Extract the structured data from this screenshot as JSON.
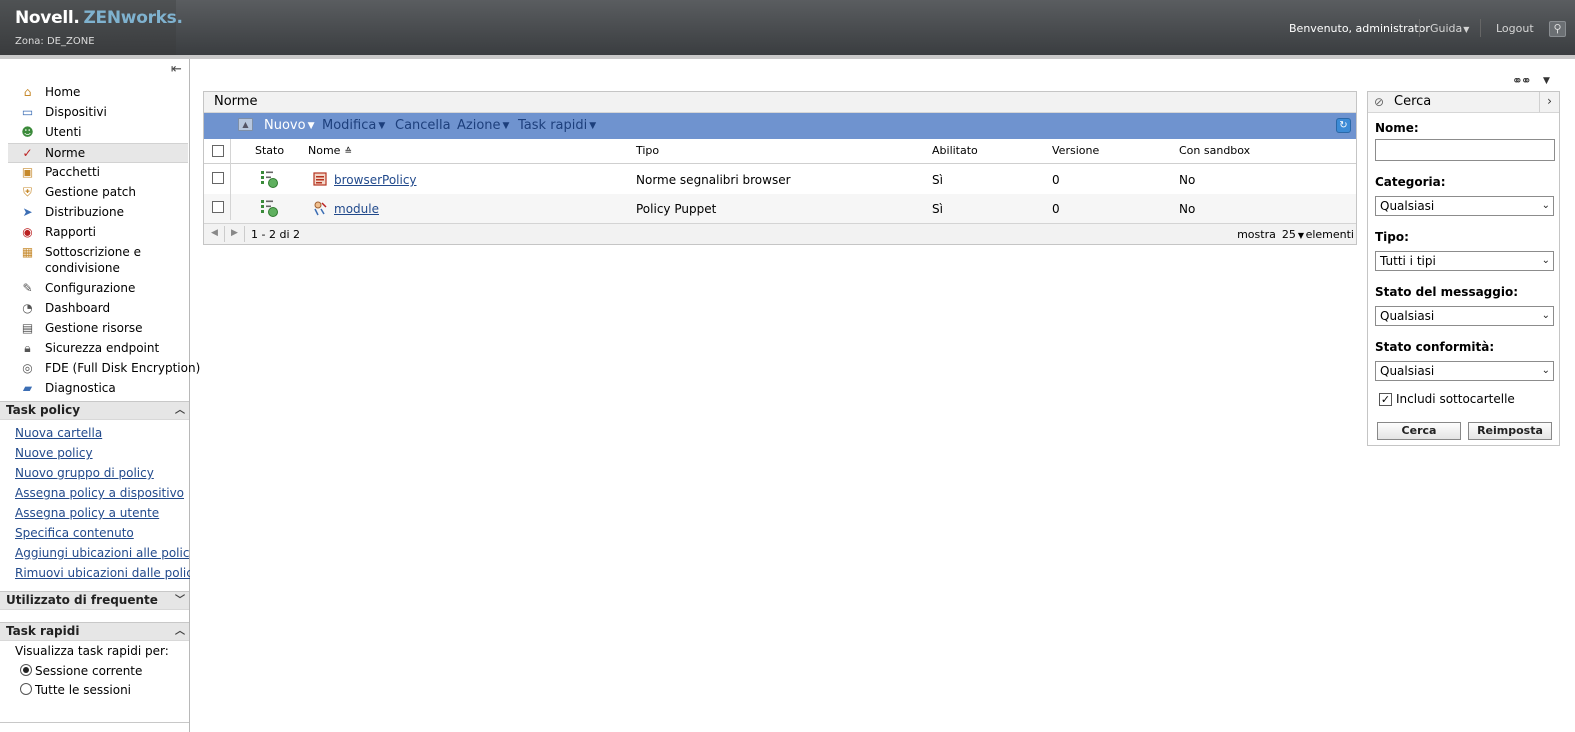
{
  "header": {
    "brand_main": "Novell.",
    "brand_product": "ZENworks.",
    "zone": "Zona: DE_ZONE",
    "welcome": "Benvenuto, administrator",
    "help": "Guida",
    "logout": "Logout"
  },
  "nav": {
    "items": [
      {
        "label": "Home",
        "icon": "home-icon"
      },
      {
        "label": "Dispositivi",
        "icon": "devices-icon"
      },
      {
        "label": "Utenti",
        "icon": "users-icon"
      },
      {
        "label": "Norme",
        "icon": "policy-icon",
        "selected": true
      },
      {
        "label": "Pacchetti",
        "icon": "bundles-icon"
      },
      {
        "label": "Gestione patch",
        "icon": "patch-icon"
      },
      {
        "label": "Distribuzione",
        "icon": "deployment-icon"
      },
      {
        "label": "Rapporti",
        "icon": "reports-icon"
      },
      {
        "label": "Sottoscrizione e condivisione",
        "icon": "subscription-icon"
      },
      {
        "label": "Configurazione",
        "icon": "configuration-icon"
      },
      {
        "label": "Dashboard",
        "icon": "dashboard-icon"
      },
      {
        "label": "Gestione risorse",
        "icon": "asset-icon"
      },
      {
        "label": "Sicurezza endpoint",
        "icon": "endpoint-security-icon"
      },
      {
        "label": "FDE (Full Disk Encryption)",
        "icon": "disk-encryption-icon"
      },
      {
        "label": "Diagnostica",
        "icon": "diagnostics-icon"
      }
    ]
  },
  "task_policy": {
    "title": "Task policy",
    "links": [
      "Nuova cartella",
      "Nuove policy",
      "Nuovo gruppo di policy",
      "Assegna policy a dispositivo",
      "Assegna policy a utente",
      "Specifica contenuto",
      "Aggiungi ubicazioni alle policy",
      "Rimuovi ubicazioni dalle policy"
    ]
  },
  "frequent": {
    "title": "Utilizzato di frequente"
  },
  "quick_tasks": {
    "title": "Task rapidi",
    "label": "Visualizza task rapidi per:",
    "options": [
      "Sessione corrente",
      "Tutte le sessioni"
    ],
    "selected": 0
  },
  "panel": {
    "title": "Norme",
    "toolbar": {
      "new": "Nuovo",
      "edit": "Modifica",
      "delete": "Cancella",
      "action": "Azione",
      "quick_tasks": "Task rapidi"
    },
    "columns": {
      "status": "Stato",
      "name": "Nome",
      "type": "Tipo",
      "enabled": "Abilitato",
      "version": "Versione",
      "sandbox": "Con sandbox"
    },
    "rows": [
      {
        "name": "browserPolicy",
        "type": "Norme segnalibri browser",
        "enabled": "Sì",
        "version": "0",
        "sandbox": "No"
      },
      {
        "name": "module",
        "type": "Policy Puppet",
        "enabled": "Sì",
        "version": "0",
        "sandbox": "No"
      }
    ],
    "pager": {
      "range": "1 - 2 di 2",
      "show": "mostra",
      "size": "25",
      "items": "elementi"
    }
  },
  "search": {
    "title": "Cerca",
    "name_label": "Nome:",
    "name_value": "",
    "category_label": "Categoria:",
    "category_value": "Qualsiasi",
    "type_label": "Tipo:",
    "type_value": "Tutti i tipi",
    "message_label": "Stato del messaggio:",
    "message_value": "Qualsiasi",
    "compliance_label": "Stato conformità:",
    "compliance_value": "Qualsiasi",
    "include_sub": "Includi sottocartelle",
    "include_sub_checked": true,
    "search_btn": "Cerca",
    "reset_btn": "Reimposta"
  },
  "colors": {
    "toolbar": "#6f93cf",
    "link": "#224a8c",
    "header": "#474a4d"
  }
}
